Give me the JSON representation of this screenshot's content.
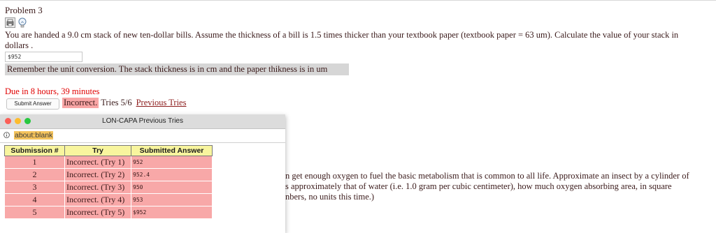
{
  "problem": {
    "title": "Problem 3",
    "question_line1": "You are handed a 9.0 cm stack of new ten-dollar bills. Assume the thickness of a bill is 1.5 times thicker than your textbook paper (textbook paper = 63 um). Calculate the value of your stack in",
    "question_line2": "dollars .",
    "answer_value": "$952",
    "hint": "Remember the unit conversion. The stack thickness is in cm and the paper thikness is in um",
    "due": "Due in 8 hours, 39 minutes",
    "submit_label": "Submit Answer",
    "status_badge": "Incorrect.",
    "tries": "Tries 5/6",
    "previous_tries_link": "Previous Tries"
  },
  "background_problem": {
    "line1": "n get enough oxygen to fuel the basic metabolism that is common to all life. Approximate an insect by a cylinder of",
    "line2": "s approximately that of water (i.e. 1.0 gram per cubic centimeter), how much oxygen absorbing area, in square",
    "line3": "nbers, no units this time.)"
  },
  "popup": {
    "title": "LON-CAPA Previous Tries",
    "url": "about:blank",
    "columns": [
      "Submission #",
      "Try",
      "Submitted Answer"
    ],
    "rows": [
      {
        "submission": "1",
        "try": "Incorrect. (Try 1)",
        "answer": "952"
      },
      {
        "submission": "2",
        "try": "Incorrect. (Try 2)",
        "answer": "952.4"
      },
      {
        "submission": "3",
        "try": "Incorrect. (Try 3)",
        "answer": "950"
      },
      {
        "submission": "4",
        "try": "Incorrect. (Try 4)",
        "answer": "953"
      },
      {
        "submission": "5",
        "try": "Incorrect. (Try 5)",
        "answer": "$952"
      }
    ]
  },
  "colors": {
    "due": "#e00000",
    "incorrect_bg": "#f8a5a5",
    "table_header_bg": "#f8f59e",
    "table_row_bg": "#f8a8a8",
    "hint_bg": "#d6d6d6",
    "url_highlight": "#f4c35c"
  },
  "icons": [
    "print-icon",
    "lightbulb-icon",
    "info-icon"
  ]
}
